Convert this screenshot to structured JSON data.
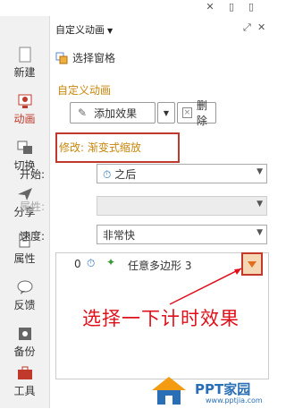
{
  "sidebar": {
    "items": [
      {
        "label": "新建",
        "icon": "new-document-icon"
      },
      {
        "label": "动画",
        "icon": "animation-icon"
      },
      {
        "label": "切换",
        "icon": "transition-icon"
      },
      {
        "label": "分享",
        "icon": "share-icon"
      },
      {
        "label": "属性",
        "icon": "properties-icon"
      },
      {
        "label": "反馈",
        "icon": "feedback-icon"
      },
      {
        "label": "备份",
        "icon": "backup-icon"
      },
      {
        "label": "工具",
        "icon": "toolbox-icon"
      }
    ],
    "active": "动画"
  },
  "panel": {
    "title": "自定义动画",
    "selection_pane": "选择窗格",
    "section_title": "自定义动画",
    "add_effect": "添加效果",
    "delete": "删除",
    "modify": "修改: 渐变式缩放",
    "start_label": "开始:",
    "start_value": "之后",
    "property_label": "属性:",
    "property_value": "",
    "speed_label": "速度:",
    "speed_value": "非常快",
    "list": [
      {
        "index": "0",
        "name": "任意多边形 3"
      }
    ]
  },
  "annotation": "选择一下计时效果",
  "watermark": {
    "text": "PPT家园",
    "url": "www.pptjia.com"
  },
  "colors": {
    "accent": "#c8860a",
    "highlight": "#c0392b",
    "annotation": "#e0101a"
  }
}
